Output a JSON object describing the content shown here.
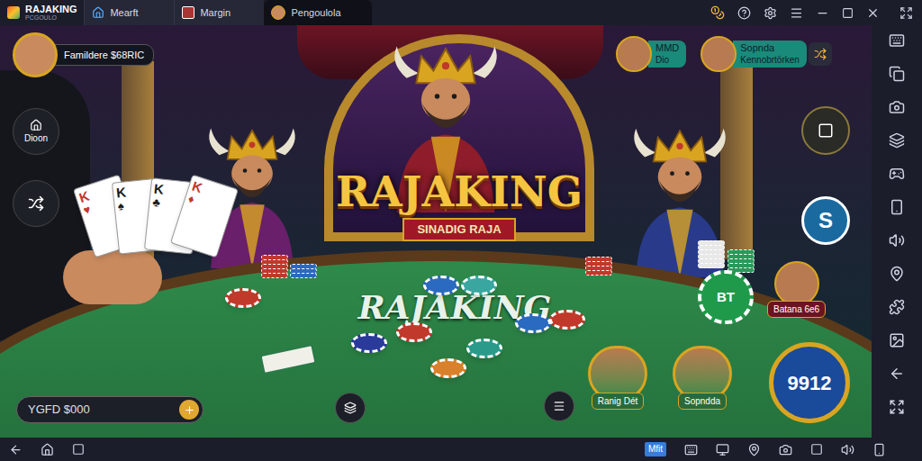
{
  "emulator": {
    "tabs": [
      {
        "label": "RAJAKING",
        "sub": "PCGOULO",
        "selected": true
      },
      {
        "label": "Mearft",
        "selected": false
      },
      {
        "label": "Margin",
        "selected": false
      },
      {
        "label": "Pengoulola",
        "selected": false
      }
    ],
    "bottom_badge": "Mfit"
  },
  "game": {
    "player": {
      "name": "Famildere $68RIC"
    },
    "opponents_top": [
      {
        "name": "MMD",
        "sub": "Dio"
      },
      {
        "name": "Sopnda",
        "sub": "Kennobrtörken"
      }
    ],
    "side_button": "Dioon",
    "currency_button": "S",
    "logo": {
      "title": "RAJAKING",
      "subtitle": "SINADIG RAJA"
    },
    "table_text": "RAJAKING",
    "chip_label": "BT",
    "cards": [
      {
        "rank": "K",
        "suit": "♥",
        "color": "#c0392b"
      },
      {
        "rank": "K",
        "suit": "♠",
        "color": "#1a1a1a"
      },
      {
        "rank": "K",
        "suit": "♣",
        "color": "#1a1a1a"
      },
      {
        "rank": "K",
        "suit": "♦",
        "color": "#c0392b"
      }
    ],
    "balance": "YGFD $000",
    "seats": [
      {
        "name": "Batana 6e6"
      },
      {
        "name": "Ranig Dét"
      },
      {
        "name": "Sopndda"
      }
    ],
    "pot": "9912"
  }
}
